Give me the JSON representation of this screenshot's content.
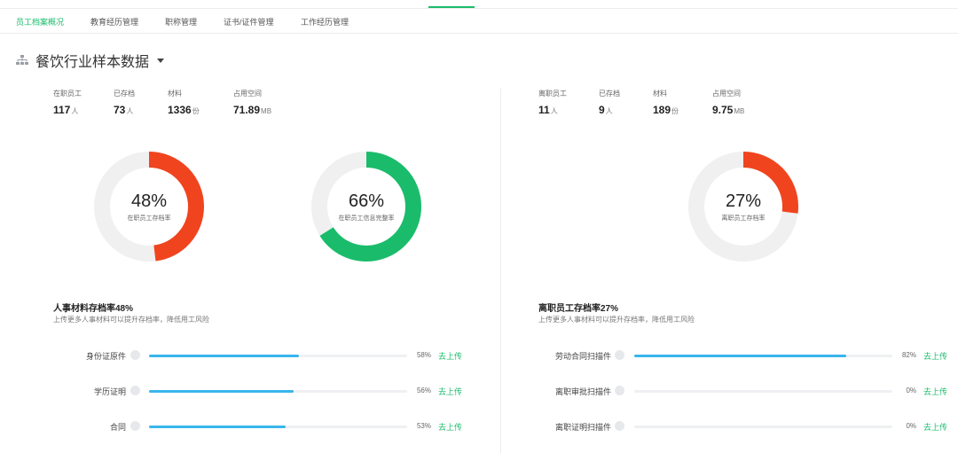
{
  "tabs": [
    "员工档案概况",
    "教育经历管理",
    "职称管理",
    "证书/证件管理",
    "工作经历管理"
  ],
  "header": {
    "title": "餐饮行业样本数据"
  },
  "left": {
    "stats": [
      {
        "label": "在职员工",
        "value": "117",
        "unit": "人"
      },
      {
        "label": "已存档",
        "value": "73",
        "unit": "人"
      },
      {
        "label": "材料",
        "value": "1336",
        "unit": "份"
      },
      {
        "label": "占用空间",
        "value": "71.89",
        "unit": "MB"
      }
    ],
    "donuts": [
      {
        "percent": "48%",
        "fraction": 0.48,
        "caption": "在职员工存档率",
        "color": "#f0441f"
      },
      {
        "percent": "66%",
        "fraction": 0.66,
        "caption": "在职员工信息完整率",
        "color": "#1abc6b"
      }
    ],
    "section_title": "人事材料存档率48%",
    "section_subtitle": "上传更多人事材料可以提升存档率，降低用工风险",
    "rows": [
      {
        "label": "身份证原件",
        "fraction": 0.58,
        "percent": "58%",
        "action": "去上传"
      },
      {
        "label": "学历证明",
        "fraction": 0.56,
        "percent": "56%",
        "action": "去上传"
      },
      {
        "label": "合同",
        "fraction": 0.53,
        "percent": "53%",
        "action": "去上传"
      }
    ]
  },
  "right": {
    "stats": [
      {
        "label": "离职员工",
        "value": "11",
        "unit": "人"
      },
      {
        "label": "已存档",
        "value": "9",
        "unit": "人"
      },
      {
        "label": "材料",
        "value": "189",
        "unit": "份"
      },
      {
        "label": "占用空间",
        "value": "9.75",
        "unit": "MB"
      }
    ],
    "donut": {
      "percent": "27%",
      "fraction": 0.27,
      "caption": "离职员工存档率",
      "color": "#f0441f"
    },
    "section_title": "离职员工存档率27%",
    "section_subtitle": "上传更多人事材料可以提升存档率，降低用工风险",
    "rows": [
      {
        "label": "劳动合同扫描件",
        "fraction": 0.82,
        "percent": "82%",
        "action": "去上传"
      },
      {
        "label": "离职审批扫描件",
        "fraction": 0,
        "percent": "0%",
        "action": "去上传"
      },
      {
        "label": "离职证明扫描件",
        "fraction": 0,
        "percent": "0%",
        "action": "去上传"
      }
    ]
  },
  "colors": {
    "accent_green": "#1abc6b",
    "accent_red": "#f0441f",
    "bar_blue": "#38b6ec",
    "track_gray": "#f0f0f0"
  }
}
